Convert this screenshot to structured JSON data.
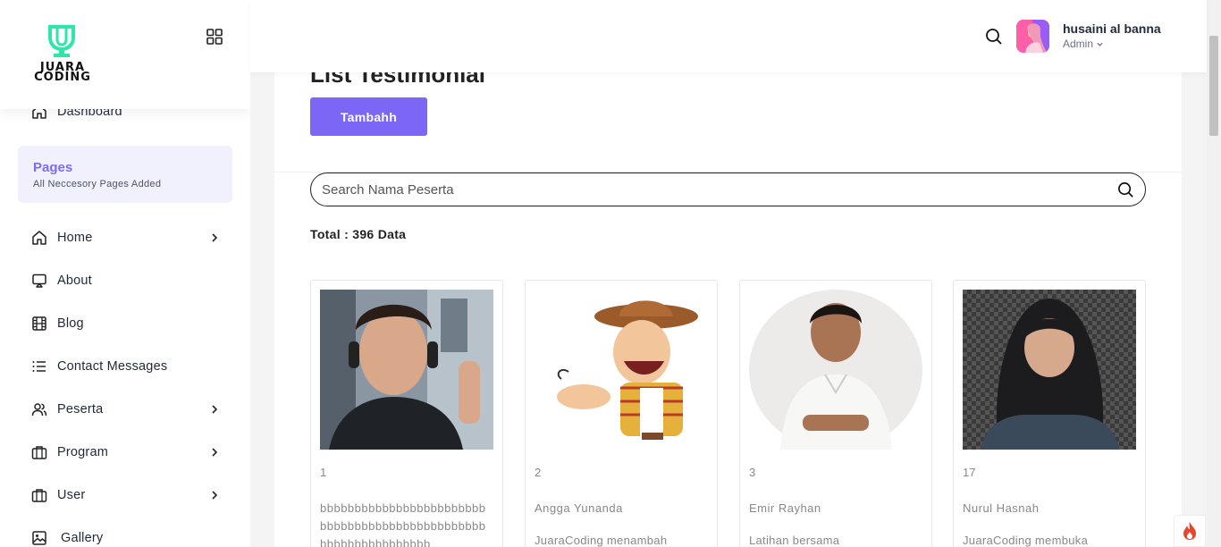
{
  "brand": {
    "logo_text_line1": "JUARA",
    "logo_text_line2": "CODING",
    "accent": "#2ee6a8"
  },
  "sidebar": {
    "items": [
      {
        "label": "Dashboard",
        "icon": "home-icon"
      },
      {
        "label": "Home",
        "icon": "home-icon",
        "has_chevron": true
      },
      {
        "label": "About",
        "icon": "monitor-icon"
      },
      {
        "label": "Blog",
        "icon": "film-icon"
      },
      {
        "label": "Contact Messages",
        "icon": "list-icon"
      },
      {
        "label": "Peserta",
        "icon": "users-icon",
        "has_chevron": true
      },
      {
        "label": "Program",
        "icon": "briefcase-icon",
        "has_chevron": true
      },
      {
        "label": "User",
        "icon": "briefcase-icon",
        "has_chevron": true
      },
      {
        "label": "Gallery",
        "icon": "image-icon"
      }
    ],
    "pages_section": {
      "title": "Pages",
      "subtitle": "All Neccesory Pages Added"
    }
  },
  "header": {
    "user_name": "husaini al banna",
    "user_role": "Admin"
  },
  "main": {
    "title": "List Testimonial",
    "add_button": "Tambahh",
    "search_placeholder": "Search Nama Peserta",
    "total_label": "Total : 396 Data",
    "cards": [
      {
        "id": "1",
        "name": "bbbbbbbbbbbbbbbbbbbbbbbbbbbbbbbbbbbbbbbbbbbbbbbbbbbbbbbbbbbbbbbb",
        "text": ""
      },
      {
        "id": "2",
        "name": "Angga Yunanda",
        "text": "JuaraCoding menambah"
      },
      {
        "id": "3",
        "name": "Emir Rayhan",
        "text": "Latihan bersama"
      },
      {
        "id": "17",
        "name": "Nurul Hasnah",
        "text": "JuaraCoding membuka"
      }
    ]
  },
  "colors": {
    "primary": "#7b66f5",
    "pages_bg": "#f1f0fd",
    "pages_title": "#7c6cf0"
  }
}
